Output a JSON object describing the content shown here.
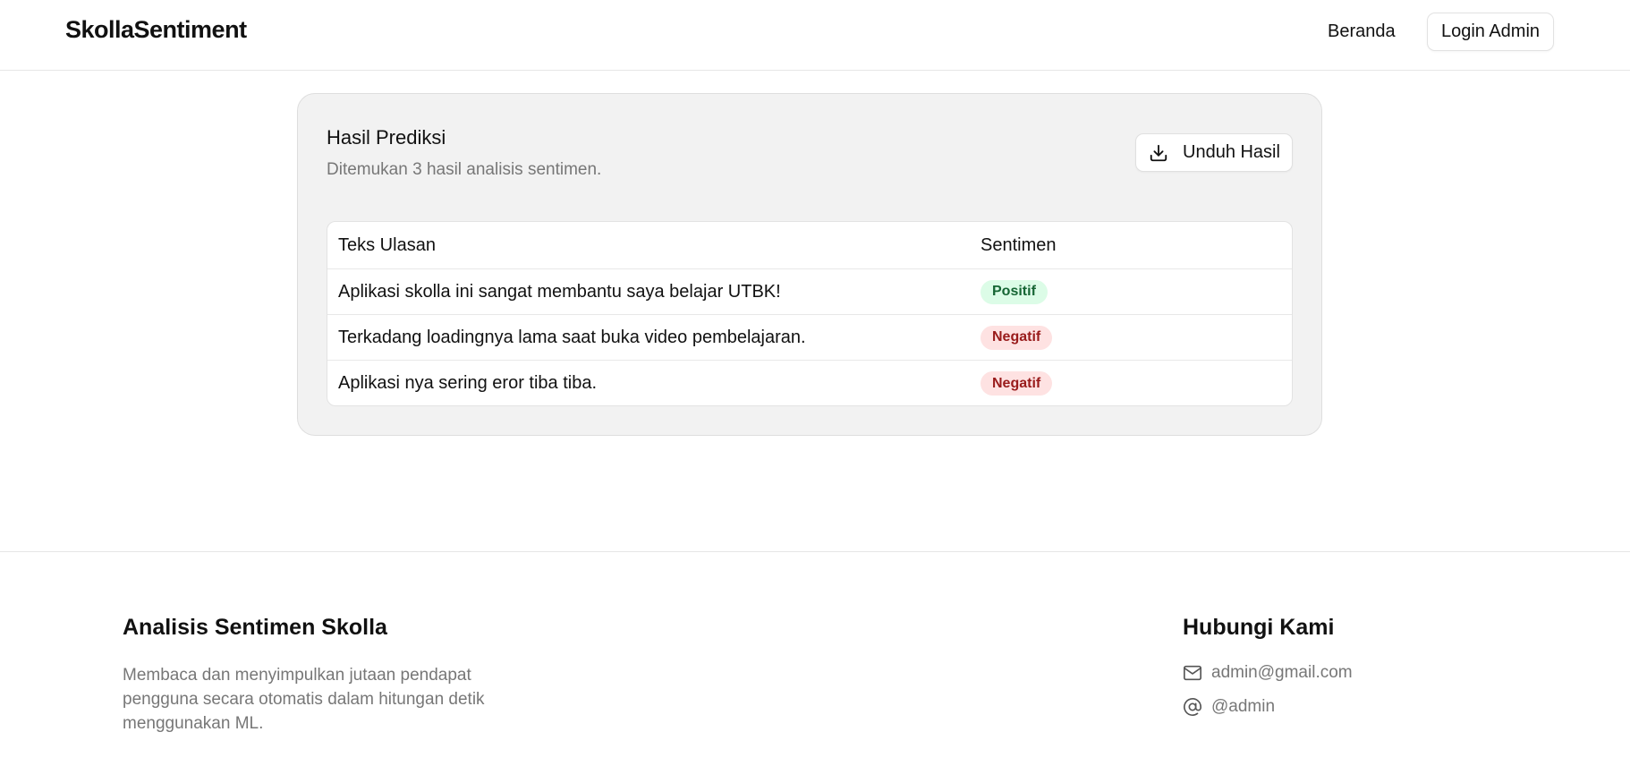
{
  "header": {
    "brand": "SkollaSentiment",
    "nav_home": "Beranda",
    "login_label": "Login Admin"
  },
  "results": {
    "title": "Hasil Prediksi",
    "subtitle": "Ditemukan 3 hasil analisis sentimen.",
    "download_label": "Unduh Hasil",
    "download_icon": "download-icon",
    "columns": [
      "Teks Ulasan",
      "Sentimen"
    ],
    "rows": [
      {
        "text": "Aplikasi skolla ini sangat membantu saya belajar UTBK!",
        "sentiment": "Positif"
      },
      {
        "text": "Terkadang loadingnya lama saat buka video pembelajaran.",
        "sentiment": "Negatif"
      },
      {
        "text": "Aplikasi nya sering eror tiba tiba.",
        "sentiment": "Negatif"
      }
    ]
  },
  "footer": {
    "title": "Analisis Sentimen Skolla",
    "description": "Membaca dan menyimpulkan jutaan pendapat pengguna secara otomatis dalam hitungan detik menggunakan ML.",
    "contact_title": "Hubungi Kami",
    "email": "admin@gmail.com",
    "email_icon": "mail-icon",
    "handle": "@admin",
    "handle_icon": "at-sign-icon"
  },
  "colors": {
    "positive_bg": "#dcfce7",
    "positive_text": "#166534",
    "negative_bg": "#fee2e2",
    "negative_text": "#991b1b",
    "card_bg": "#f2f2f2"
  }
}
